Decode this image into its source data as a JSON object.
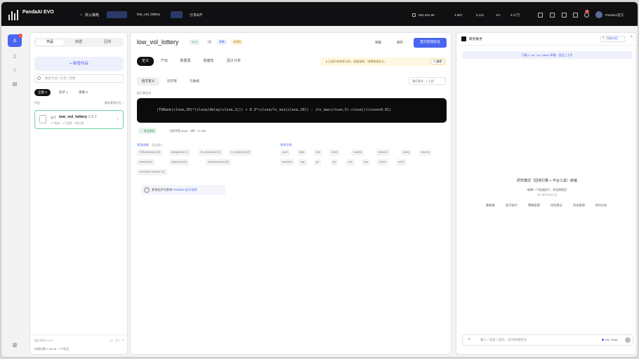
{
  "topbar": {
    "brand": "PandaAI EVO",
    "brand_sub": "",
    "workspace": "默认策略",
    "workspace_tag": "",
    "doc": "low_vol_lottery",
    "doc_tag": "",
    "action": "分享&开",
    "right": [
      {
        "label": "993,494.98"
      },
      {
        "label": "4.98T"
      },
      {
        "label": "8.22s"
      },
      {
        "label": "1%"
      },
      {
        "label": "8.27万"
      }
    ],
    "badge_count": "3",
    "user": "PandaAI官方"
  },
  "rail": {
    "badge": "3"
  },
  "works_panel": {
    "tabs": [
      "作品",
      "数据",
      "回测"
    ],
    "new_button": "+ 新增作品",
    "search_placeholder": "搜索作品 / 标签 / 策略",
    "chips": [
      {
        "label": "全部 3"
      },
      {
        "label": "因子 1"
      },
      {
        "label": "策略 0"
      }
    ],
    "list_head_left": "作品",
    "list_head_right": "最新更新优先 ↕",
    "item": {
      "tag": "因子",
      "title": "low_vol_lottery",
      "version": "2.0.1",
      "meta": "1个版本 · 1个回测 · 2周以前"
    },
    "footer_a": "最近更新 2025",
    "footer_b": "1/1 · 共 1 个",
    "footer_c": "存储总数 2.98 KB · 1个作品"
  },
  "editor": {
    "title": "low_vol_lottery",
    "badges": [
      "2.0.1",
      "1版",
      "草稿",
      "未保存"
    ],
    "header_buttons": [
      "草稿",
      "保存"
    ],
    "primary": "提交回测验证",
    "tabs": [
      "定义",
      "产出",
      "数据源",
      "稳健性",
      "因子分析"
    ],
    "notice": "已进行有效性分析，若要继续，则需修改定义。",
    "notice_button": "✎ 编辑",
    "subtabs": [
      "因子定义",
      "因子库",
      "元数据"
    ],
    "version_select": "最近版本 · 1 之前",
    "formula_label": "因子表达式",
    "formula": "(TSRank(close,20)*(close/delay(close,1))) + 0.3*(close/ts_min(close,20)) - (ts_max(close,5)-close)/(close+0.01)",
    "formula_actions": [
      "✓ 语法校验",
      "当前字段 close · 5种 · 1Y 60d"
    ],
    "section_left": "常用函数",
    "section_left_muted": "· 点击插入",
    "section_right": "常用字段",
    "left_fields": [
      "TSRank(close,20)",
      "delay(close,1)",
      "ts_min(close,20)",
      "ts_max(close,5)",
      "rank(close)",
      "std(close,20)",
      "mean(volume,20)",
      "corr(close,volume,10)",
      "log(close)"
    ],
    "right_fields": [
      "open",
      "high",
      "low",
      "close",
      "volume",
      "amount",
      "vwap",
      "returns",
      "turnover",
      "cap",
      "pe",
      "pb",
      "roe",
      "eps",
      "ma20",
      "rsi14"
    ],
    "tip": "更多因子可参考",
    "tip_link": "PandaAI 因子说明"
  },
  "assistant": {
    "title": "研究助手",
    "header_button": "+ 新对话",
    "banner": "已载入 low_vol_lottery 草稿，会话上下文",
    "mid_title": "研究模式（回测引擎 + 平台工具）就绪",
    "mid_sub": "“新建一个低波因子，并回测验证”",
    "mid_sub2": "输入需求开始对话",
    "suggestions": [
      "看数据",
      "因子迭代",
      "策略搭建",
      "风险提示",
      "资金管理",
      "研究分析"
    ],
    "input_placeholder": "输入 / 选择 / 提问，支持快捷指令",
    "model": "DS- Flash"
  },
  "colors": {
    "accent": "#4a66f0",
    "topbar": "#101012",
    "formula_bg": "#0b0b0c"
  }
}
